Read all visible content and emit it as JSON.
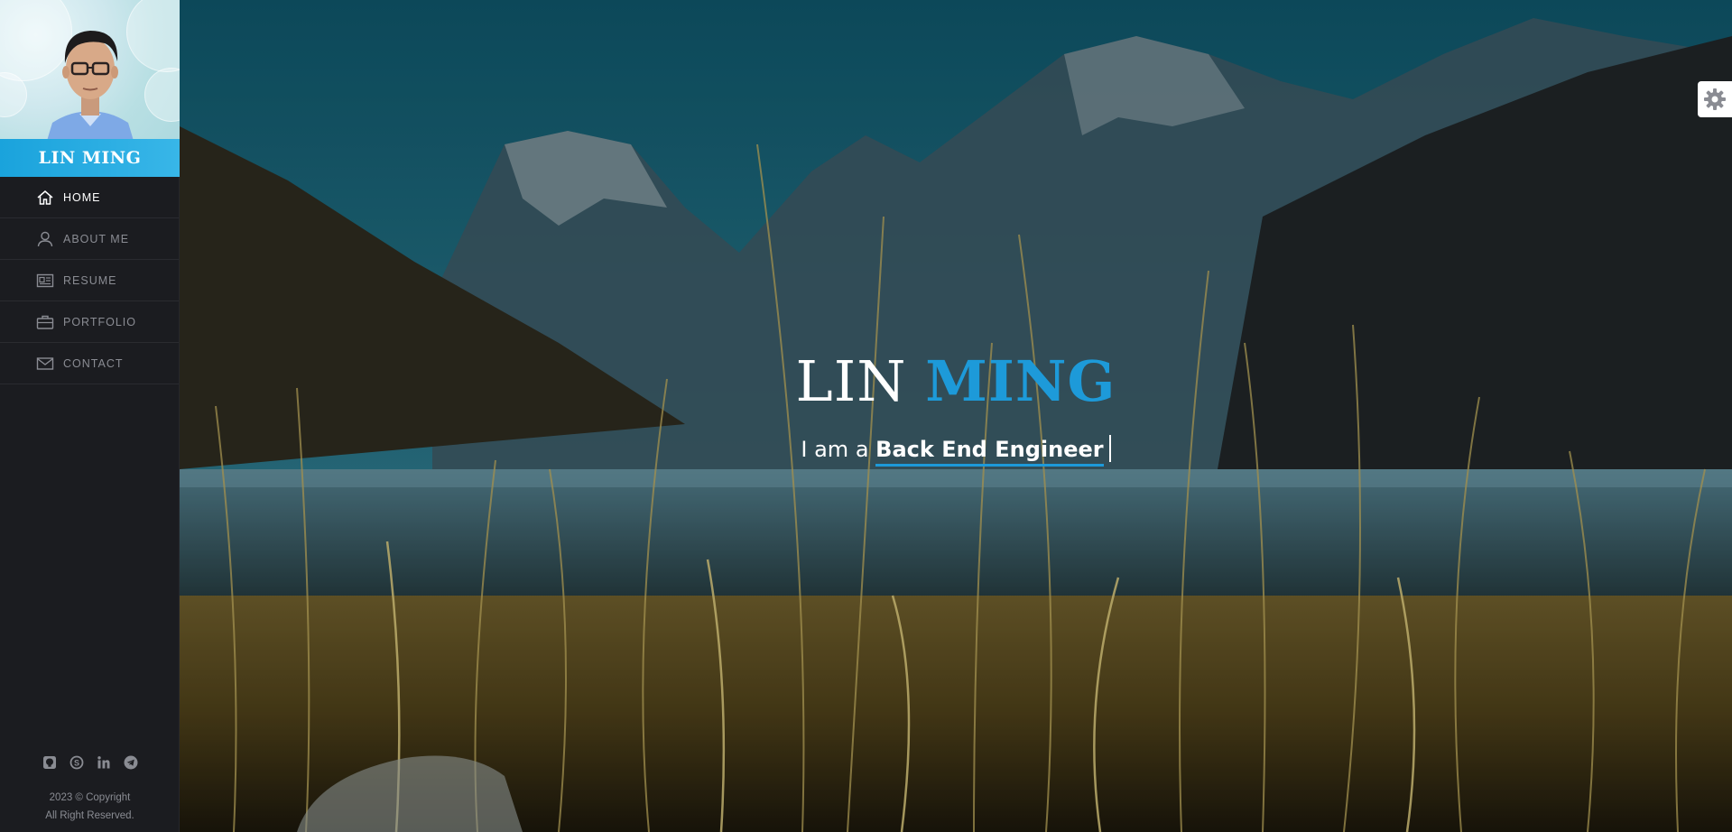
{
  "profile": {
    "name": "LIN MING"
  },
  "nav": {
    "items": [
      {
        "label": "HOME",
        "icon": "home-icon",
        "active": true
      },
      {
        "label": "ABOUT ME",
        "icon": "user-icon",
        "active": false
      },
      {
        "label": "RESUME",
        "icon": "resume-icon",
        "active": false
      },
      {
        "label": "PORTFOLIO",
        "icon": "briefcase-icon",
        "active": false
      },
      {
        "label": "CONTACT",
        "icon": "envelope-icon",
        "active": false
      }
    ]
  },
  "socials": [
    {
      "icon": "github-icon"
    },
    {
      "icon": "skype-icon"
    },
    {
      "icon": "linkedin-icon"
    },
    {
      "icon": "telegram-icon"
    }
  ],
  "footer": {
    "line1": "2023 © Copyright",
    "line2": "All Right Reserved."
  },
  "hero": {
    "first_name": "LIN",
    "last_name": "MING",
    "intro": "I am a",
    "role": "Back End Engineer"
  },
  "colors": {
    "accent": "#1d9ad9",
    "sidebar_bg": "#1b1c20",
    "name_bar": "#1aa3dc"
  }
}
